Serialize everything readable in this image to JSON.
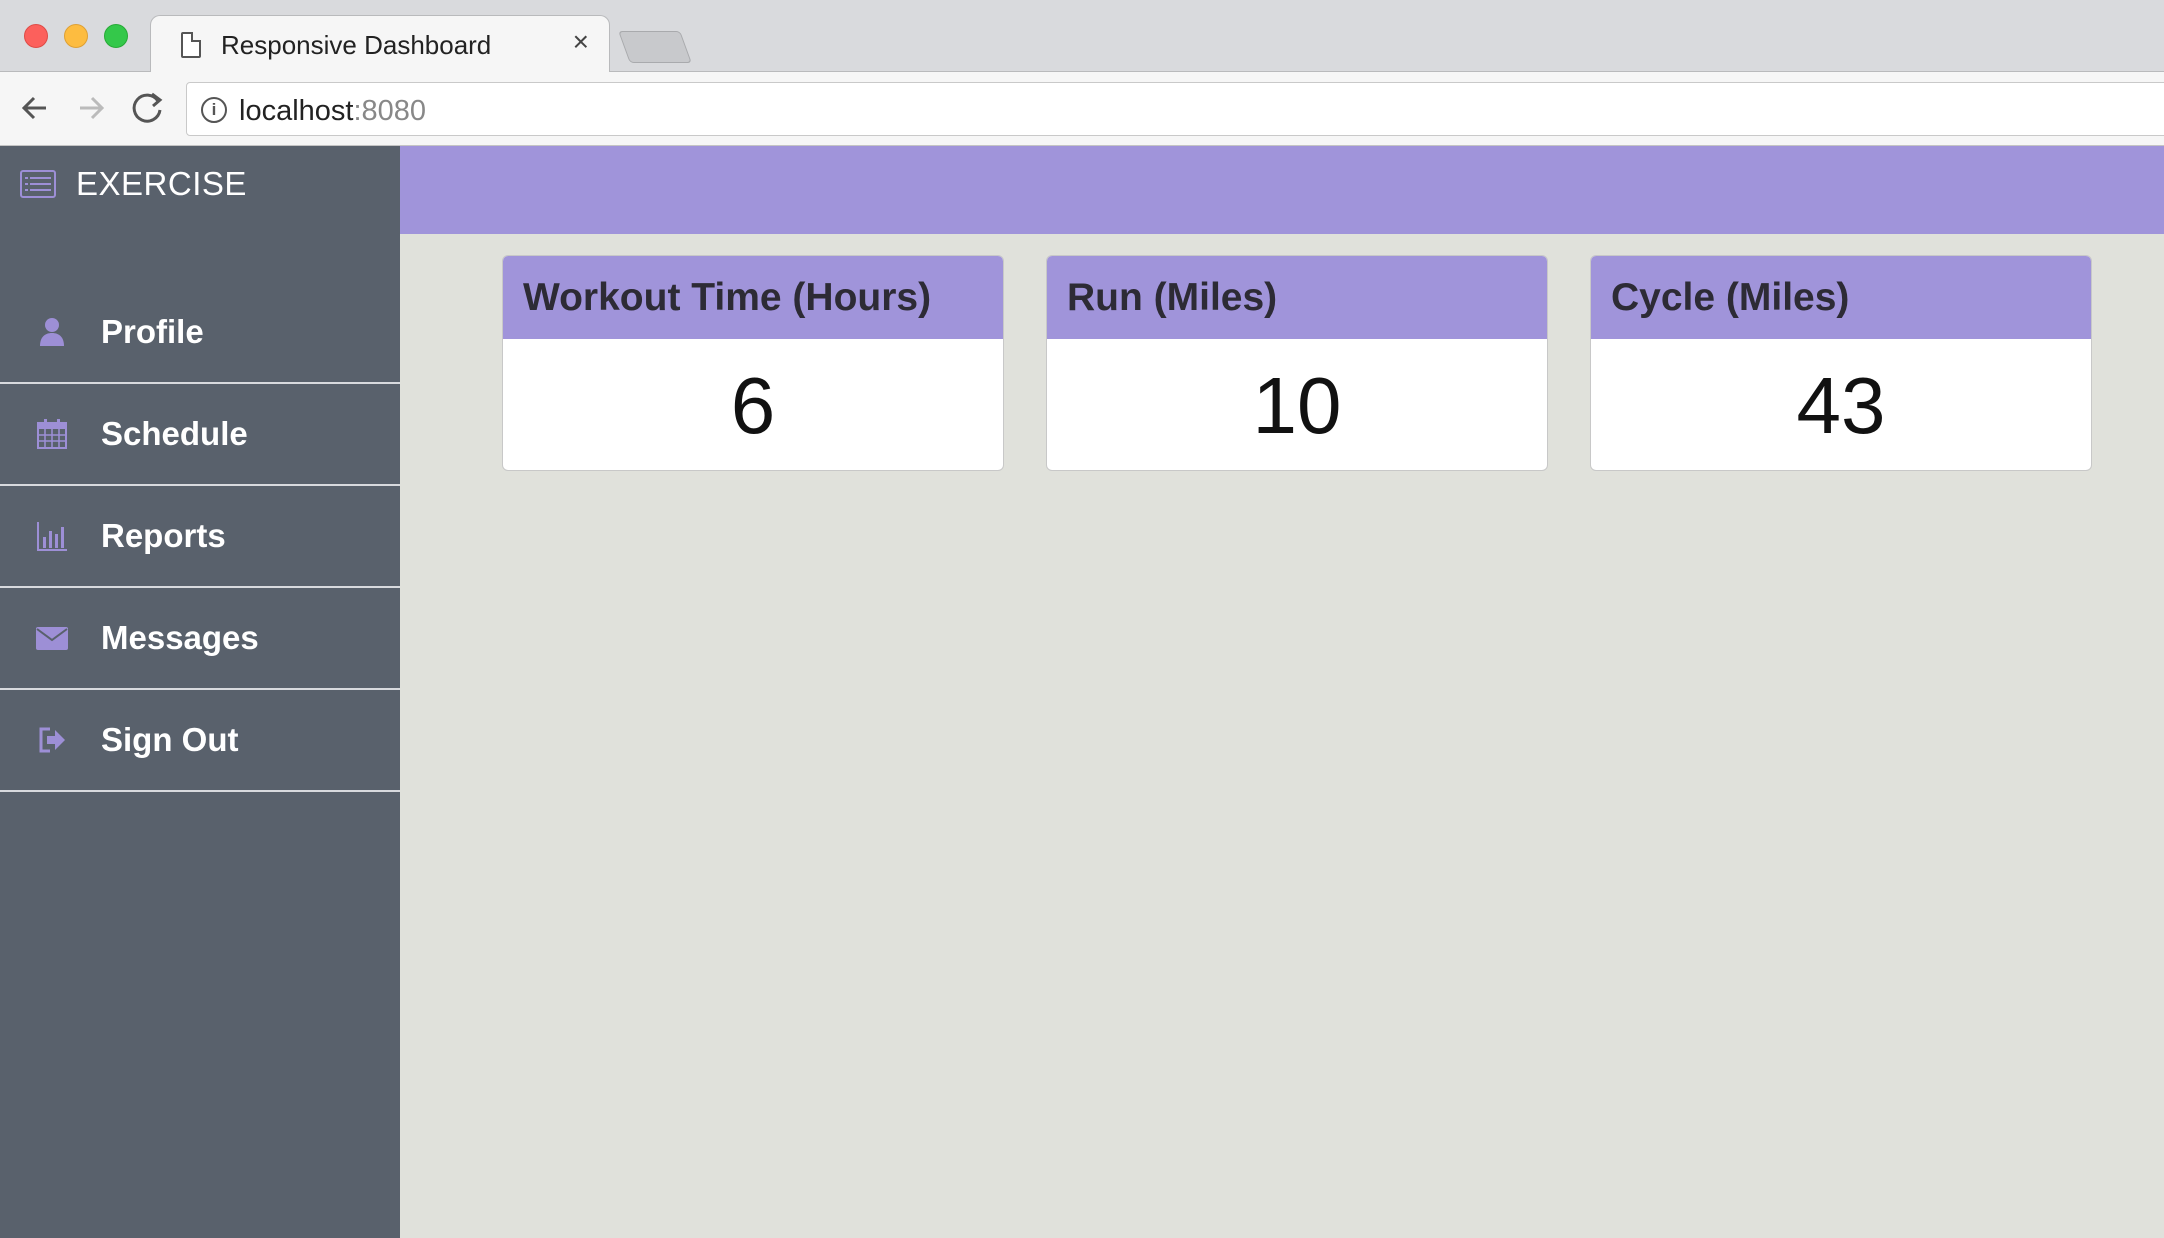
{
  "browser": {
    "tab_title": "Responsive Dashboard",
    "tab_close": "×",
    "url_host": "localhost",
    "url_port": ":8080"
  },
  "sidebar": {
    "brand": "EXERCISE",
    "items": [
      {
        "label": "Profile",
        "icon": "user-icon"
      },
      {
        "label": "Schedule",
        "icon": "calendar-icon"
      },
      {
        "label": "Reports",
        "icon": "bar-chart-icon"
      },
      {
        "label": "Messages",
        "icon": "envelope-icon"
      },
      {
        "label": "Sign Out",
        "icon": "sign-out-icon"
      }
    ]
  },
  "cards": [
    {
      "title": "Workout Time (Hours)",
      "value": "6"
    },
    {
      "title": "Run (Miles)",
      "value": "10"
    },
    {
      "title": "Cycle (Miles)",
      "value": "43"
    }
  ],
  "colors": {
    "sidebar_bg": "#59616c",
    "accent": "#a094da",
    "icon_accent": "#9d8fd6",
    "main_bg": "#e0e1db"
  }
}
